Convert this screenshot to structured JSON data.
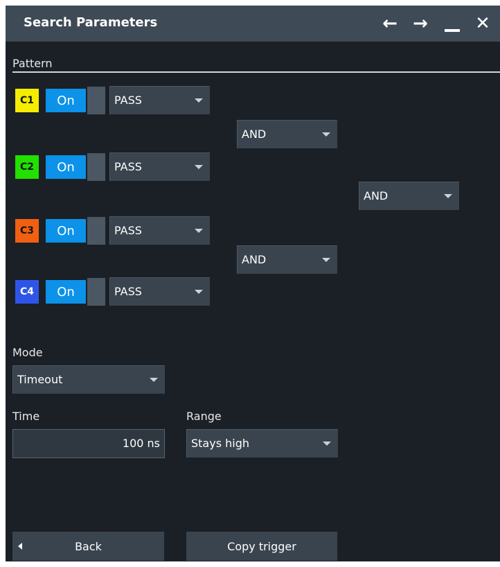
{
  "titlebar": {
    "title": "Search Parameters",
    "icons": [
      "arrow-left-icon",
      "arrow-right-icon",
      "minimize-icon",
      "close-icon"
    ],
    "icon_glyphs": {
      "back": "←",
      "forward": "→",
      "minimize": "▁",
      "close": "✕"
    }
  },
  "pattern": {
    "label": "Pattern",
    "channels": [
      {
        "name": "C1",
        "color": "#f5ec00",
        "state": "On",
        "condition": "PASS"
      },
      {
        "name": "C2",
        "color": "#22e000",
        "state": "On",
        "condition": "PASS"
      },
      {
        "name": "C3",
        "color": "#f06010",
        "state": "On",
        "condition": "PASS"
      },
      {
        "name": "C4",
        "color": "#2f55e8",
        "state": "On",
        "condition": "PASS"
      }
    ],
    "logic_c1_c2": "AND",
    "logic_c3_c4": "AND",
    "logic_final": "AND"
  },
  "mode": {
    "label": "Mode",
    "value": "Timeout"
  },
  "time": {
    "label": "Time",
    "value": "100 ns"
  },
  "range": {
    "label": "Range",
    "value": "Stays high"
  },
  "buttons": {
    "back": "Back",
    "copy_trigger": "Copy trigger"
  },
  "colors": {
    "background": "#1b2026",
    "titlebar": "#3e4a55",
    "on_toggle": "#0c92e8",
    "control": "#3a444e"
  }
}
